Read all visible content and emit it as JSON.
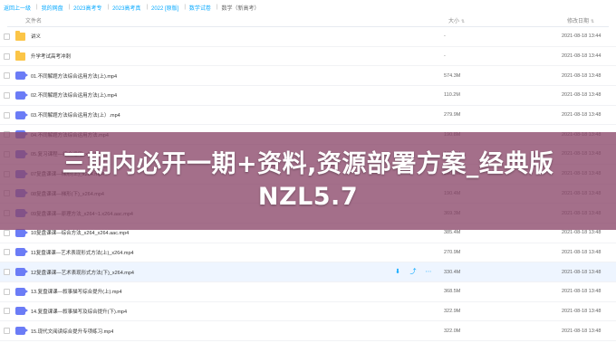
{
  "breadcrumb": {
    "items": [
      "返回上一级",
      "我的网盘",
      "2023高考专",
      "2023高考真",
      "2022 [原版]",
      "数学试卷"
    ],
    "current": "数学（新高考）"
  },
  "header": {
    "name": "文件名",
    "size": "大小",
    "date": "修改日期"
  },
  "files": [
    {
      "type": "folder",
      "name": "讲义",
      "size": "-",
      "date": "2021-08-18 13:44"
    },
    {
      "type": "folder",
      "name": "升学考试高考冲刺",
      "size": "-",
      "date": "2021-08-18 13:44"
    },
    {
      "type": "video",
      "name": "01.不同解题方法综合运用方法(上).mp4",
      "size": "574.3M",
      "date": "2021-08-18 13:48"
    },
    {
      "type": "video",
      "name": "02.不同解题方法综合运用方法(上).mp4",
      "size": "110.2M",
      "date": "2021-08-18 13:48"
    },
    {
      "type": "video",
      "name": "03.不同解题方法综合运用方法(上）.mp4",
      "size": "279.9M",
      "date": "2021-08-18 13:48"
    },
    {
      "type": "video",
      "name": "04.不同解题方法综合运用方法.mp4",
      "size": "190.8M",
      "date": "2021-08-18 13:48"
    },
    {
      "type": "video",
      "name": "05.复习课程—综合运用_x264.mp4",
      "size": "190.5M",
      "date": "2021-08-18 13:48"
    },
    {
      "type": "video",
      "name": "07复盘课课—梯形(上)_x264.mp4",
      "size": "190.4M",
      "date": "2021-08-18 13:48"
    },
    {
      "type": "video",
      "name": "08复盘课课—梯形(下)_x264.mp4",
      "size": "190.4M",
      "date": "2021-08-18 13:48"
    },
    {
      "type": "video",
      "name": "09复盘课课—原理方法_x264~1.x264.aac.mp4",
      "size": "369.3M",
      "date": "2021-08-18 13:48"
    },
    {
      "type": "video",
      "name": "10复盘课课—综合方法_x264_x264.aac.mp4",
      "size": "385.4M",
      "date": "2021-08-18 13:48"
    },
    {
      "type": "video",
      "name": "11复盘课课—艺术表现形式方法(上)_x264.mp4",
      "size": "270.9M",
      "date": "2021-08-18 13:48"
    },
    {
      "type": "video",
      "name": "12复盘课课—艺术表现形式方法(下)_x264.mp4",
      "size": "330.4M",
      "date": "2021-08-18 13:48"
    },
    {
      "type": "video",
      "name": "13.复盘课课—叙事描写综合提升(上).mp4",
      "size": "368.5M",
      "date": "2021-08-18 13:48"
    },
    {
      "type": "video",
      "name": "14.复盘课课—叙事描写及综合提升(下).mp4",
      "size": "322.9M",
      "date": "2021-08-18 13:48"
    },
    {
      "type": "video",
      "name": "15.现代文阅读综合提升专项练习.mp4",
      "size": "322.0M",
      "date": "2021-08-18 13:48"
    }
  ],
  "hover_row_actions": [
    "download-icon",
    "share-icon",
    "more-icon"
  ],
  "banner": {
    "line1": "三期内必开一期+资料,资源部署方案_经典版",
    "line2": "NZL5.7"
  },
  "colors": {
    "folder": "#fbc547",
    "video": "#6b7cf6",
    "accent": "#09aaff",
    "banner": "#8b4669"
  }
}
